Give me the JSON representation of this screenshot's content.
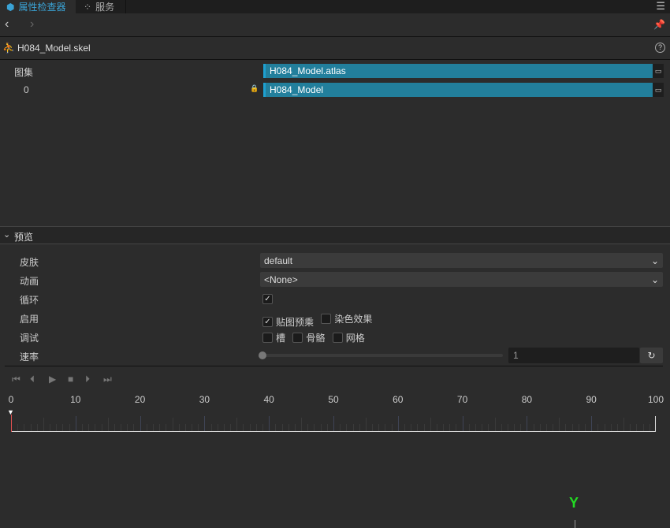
{
  "tabs": [
    {
      "label": "属性检查器",
      "icon": "inspector-icon"
    },
    {
      "label": "服务",
      "icon": "grid-icon"
    }
  ],
  "asset": {
    "name": "H084_Model.skel",
    "icon": "spine-icon"
  },
  "atlas": {
    "label": "图集",
    "value": "H084_Model.atlas",
    "index_label": "0",
    "index_value": "H084_Model"
  },
  "preview": {
    "title": "预览",
    "skin": {
      "label": "皮肤",
      "value": "default"
    },
    "animation": {
      "label": "动画",
      "value": "<None>"
    },
    "loop": {
      "label": "循环",
      "checked": true
    },
    "enable": {
      "label": "启用",
      "premultiplied": "贴图预乘",
      "premultiplied_checked": true,
      "tint": "染色效果",
      "tint_checked": false
    },
    "debug": {
      "label": "调试",
      "slots": "槽",
      "bones": "骨骼",
      "mesh": "网格"
    },
    "speed": {
      "label": "速率",
      "value": "1",
      "slider": 0
    }
  },
  "timeline": {
    "ticks": [
      "0",
      "10",
      "20",
      "30",
      "40",
      "50",
      "60",
      "70",
      "80",
      "90",
      "100"
    ],
    "current": 0
  },
  "axis_label": "Y",
  "colors": {
    "accent": "#3aa3d6",
    "asset": "#227f9c",
    "axis": "#22dd22"
  }
}
